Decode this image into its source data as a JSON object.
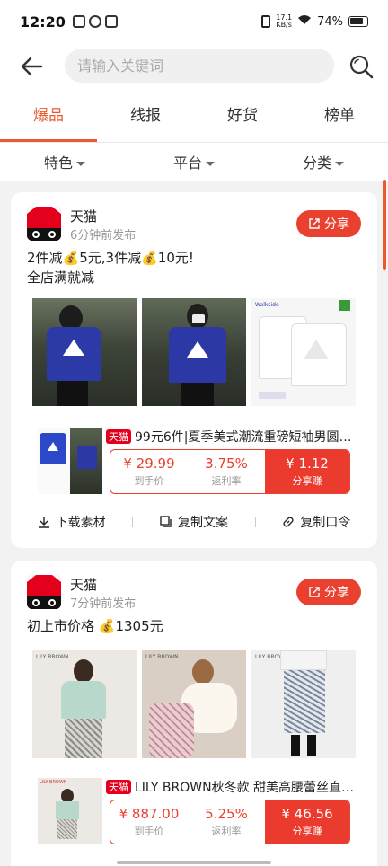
{
  "status_bar": {
    "time": "12:20",
    "net_speed_value": "17.1",
    "net_speed_unit": "KB/s",
    "battery": "74%"
  },
  "search": {
    "placeholder": "请输入关键词"
  },
  "tabs": [
    {
      "label": "爆品",
      "active": true
    },
    {
      "label": "线报",
      "active": false
    },
    {
      "label": "好货",
      "active": false
    },
    {
      "label": "榜单",
      "active": false
    }
  ],
  "filters": [
    {
      "label": "特色"
    },
    {
      "label": "平台"
    },
    {
      "label": "分类"
    }
  ],
  "posts": [
    {
      "shop": "天猫",
      "time": "6分钟前发布",
      "share_label": "分享",
      "desc_line1_a": "2件减",
      "desc_line1_b": "5元,3件减",
      "desc_line1_c": "10元!",
      "desc_line2": "全店满就减",
      "product": {
        "tag": "天猫",
        "title": "99元6件|夏季美式潮流重磅短袖男圆…",
        "price": "¥ 29.99",
        "price_label": "到手价",
        "rebate": "3.75%",
        "rebate_label": "返利率",
        "earn": "¥ 1.12",
        "earn_label": "分享赚"
      },
      "actions": {
        "download": "下载素材",
        "copy_text": "复制文案",
        "copy_code": "复制口令"
      }
    },
    {
      "shop": "天猫",
      "time": "7分钟前发布",
      "share_label": "分享",
      "desc_a": "初上市价格 ",
      "desc_b": "1305元",
      "product": {
        "tag": "天猫",
        "title": "LILY BROWN秋冬款 甜美高腰蕾丝直…",
        "price": "¥ 887.00",
        "price_label": "到手价",
        "rebate": "5.25%",
        "rebate_label": "返利率",
        "earn": "¥ 46.56",
        "earn_label": "分享赚"
      }
    }
  ],
  "colors": {
    "accent": "#ea5a2c",
    "share_red": "#ea4030",
    "tmall_red": "#e4001c"
  }
}
